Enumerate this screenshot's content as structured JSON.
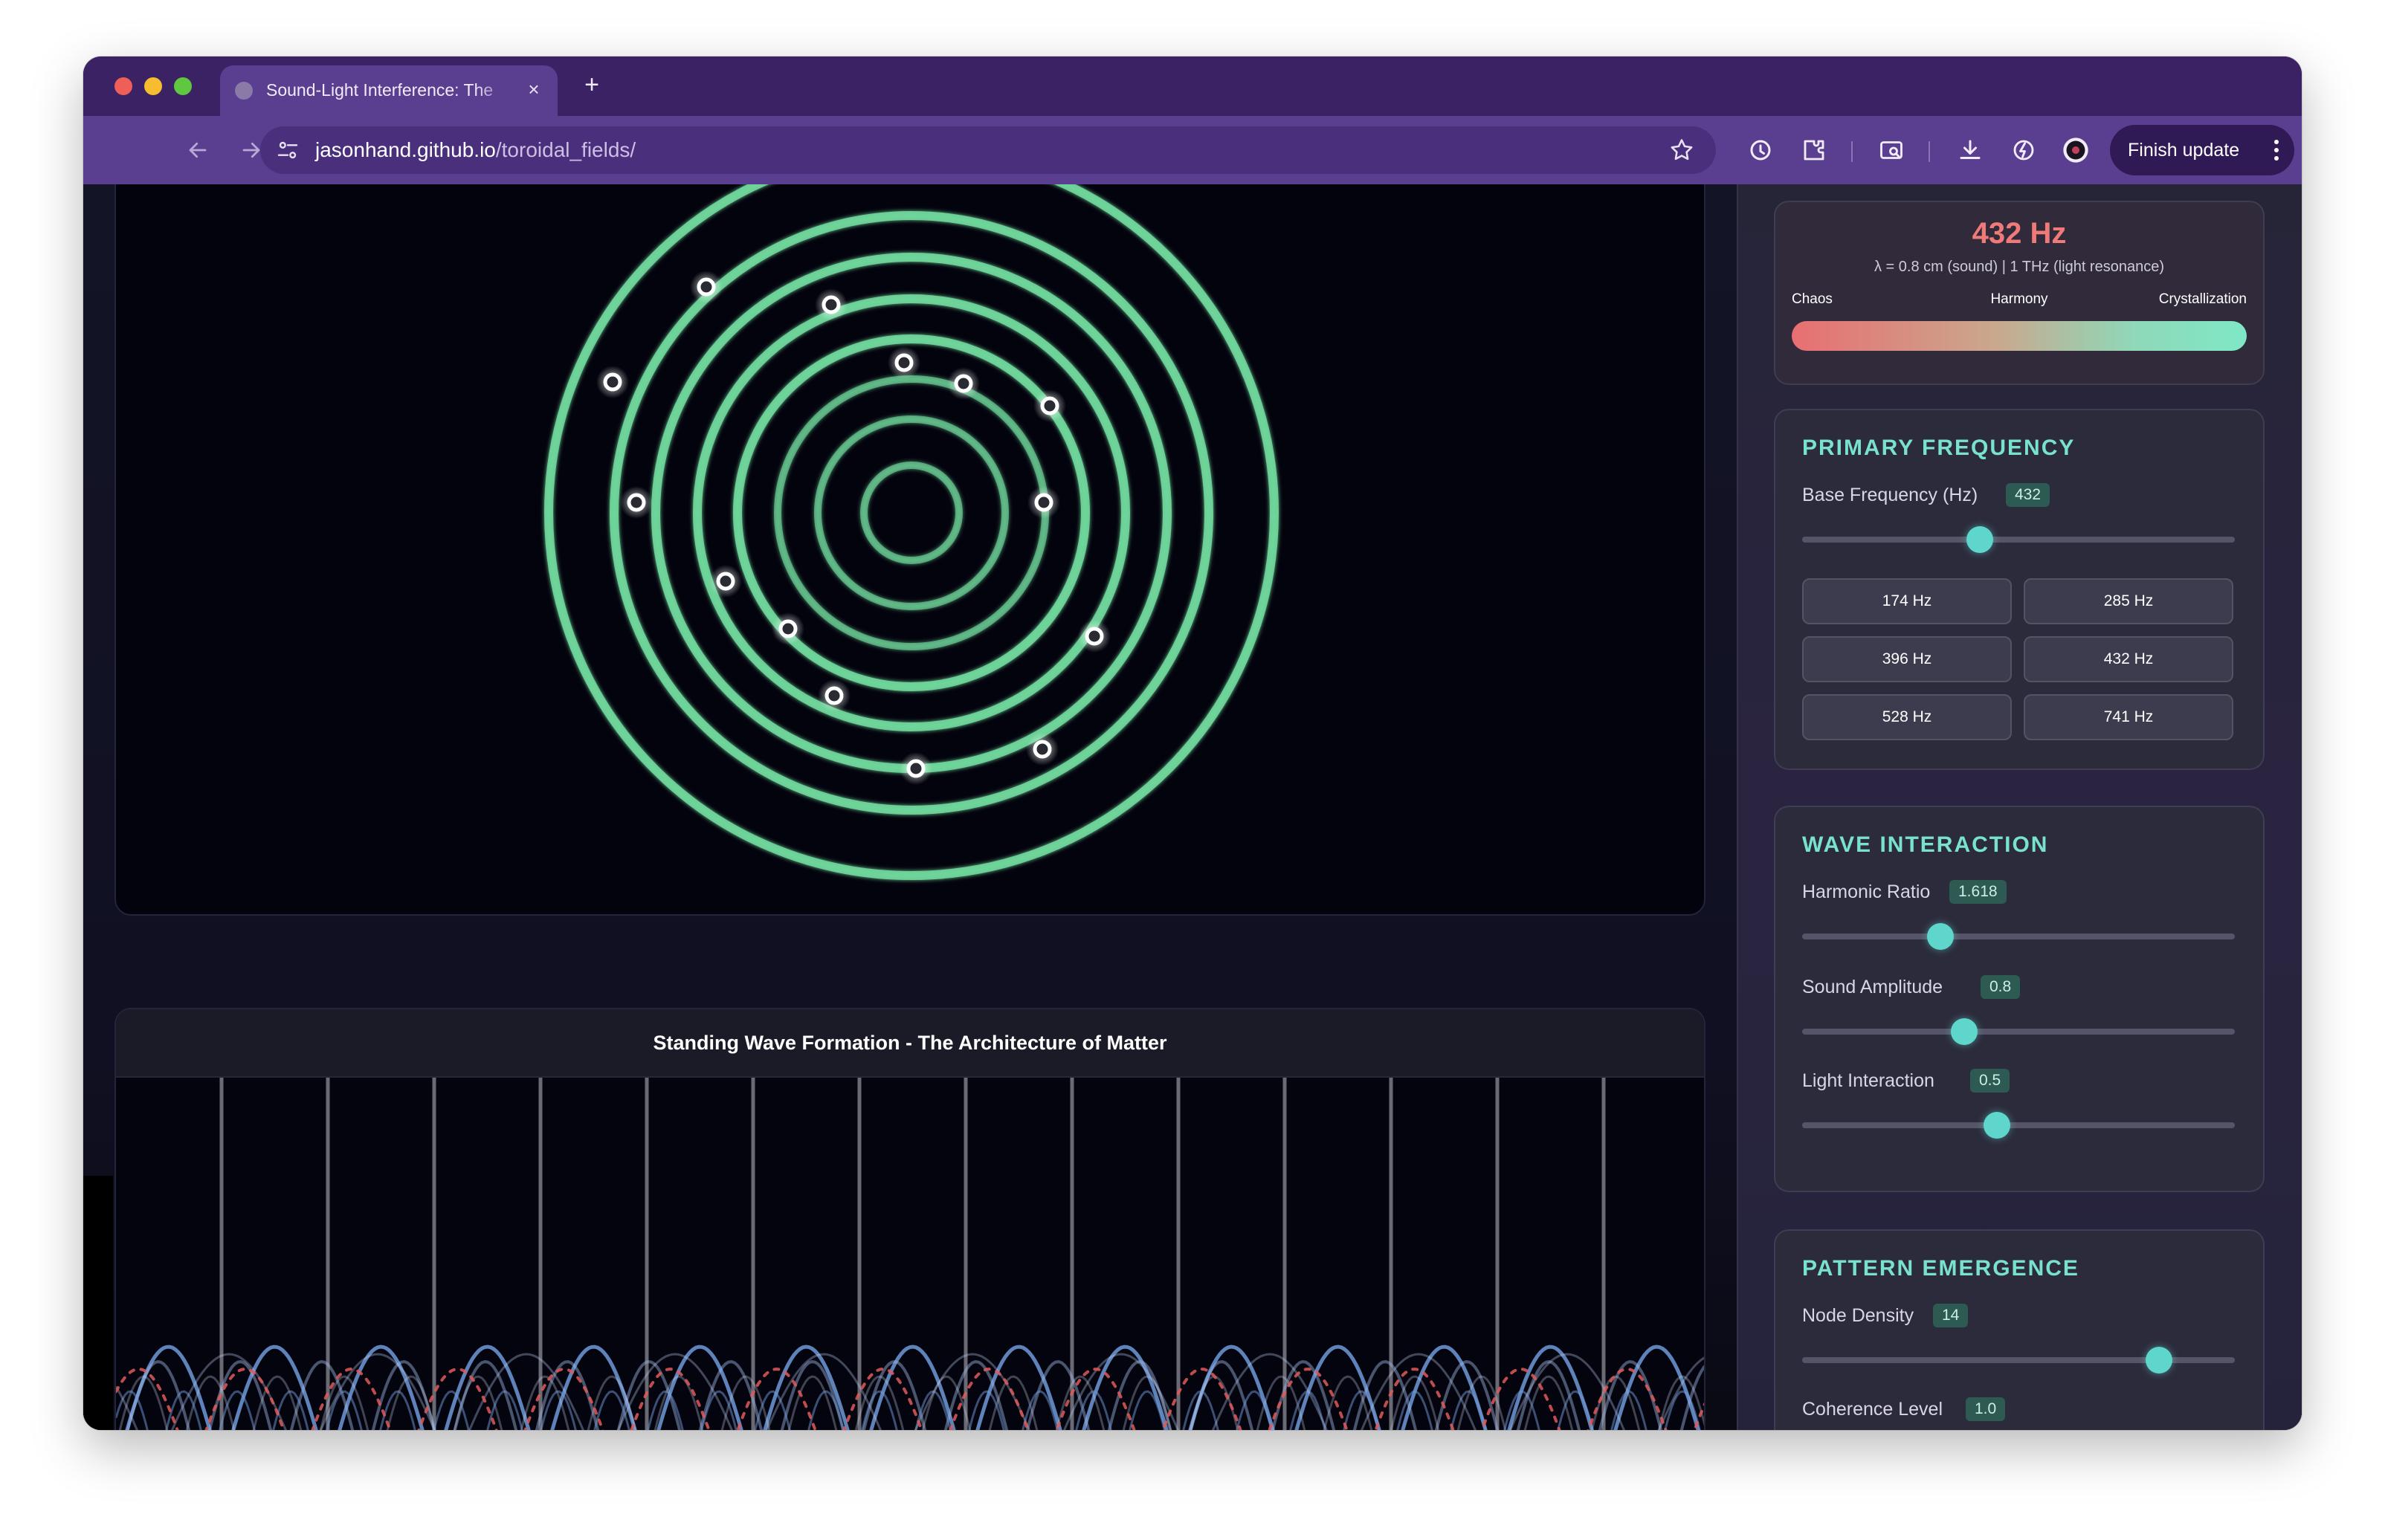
{
  "browser": {
    "tab_title": "Sound-Light Interference: The",
    "tab_close": "×",
    "new_tab": "+",
    "url_domain": "jasonhand.github.io",
    "url_path": "/toroidal_fields/",
    "finish_update_label": "Finish update"
  },
  "frequency_display": {
    "value": "432 Hz",
    "wavelength": "λ = 0.8 cm (sound) | 1 THz (light resonance)",
    "scale_left": "Chaos",
    "scale_mid": "Harmony",
    "scale_right": "Crystallization",
    "accent_color": "#f07a78"
  },
  "primary_frequency": {
    "title": "PRIMARY FREQUENCY",
    "base_label": "Base Frequency (Hz)",
    "base_value": "432",
    "base_fraction": 0.41,
    "presets": [
      "174 Hz",
      "285 Hz",
      "396 Hz",
      "432 Hz",
      "528 Hz",
      "741 Hz"
    ]
  },
  "wave_interaction": {
    "title": "WAVE INTERACTION",
    "harmonic_label": "Harmonic Ratio",
    "harmonic_value": "1.618",
    "harmonic_fraction": 0.32,
    "amplitude_label": "Sound Amplitude",
    "amplitude_value": "0.8",
    "amplitude_fraction": 0.375,
    "light_label": "Light Interaction",
    "light_value": "0.5",
    "light_fraction": 0.45
  },
  "pattern_emergence": {
    "title": "PATTERN EMERGENCE",
    "density_label": "Node Density",
    "density_value": "14",
    "density_fraction": 0.825,
    "coherence_label": "Coherence Level",
    "coherence_value": "1.0"
  },
  "standing_wave": {
    "title": "Standing Wave Formation - The Architecture of Matter",
    "node_count": 14
  },
  "colors": {
    "ring_green": "#6fd69a",
    "accent_teal": "#78e2cf",
    "wave_blue": "#6f9ad8",
    "wave_red": "#e05a5a"
  }
}
